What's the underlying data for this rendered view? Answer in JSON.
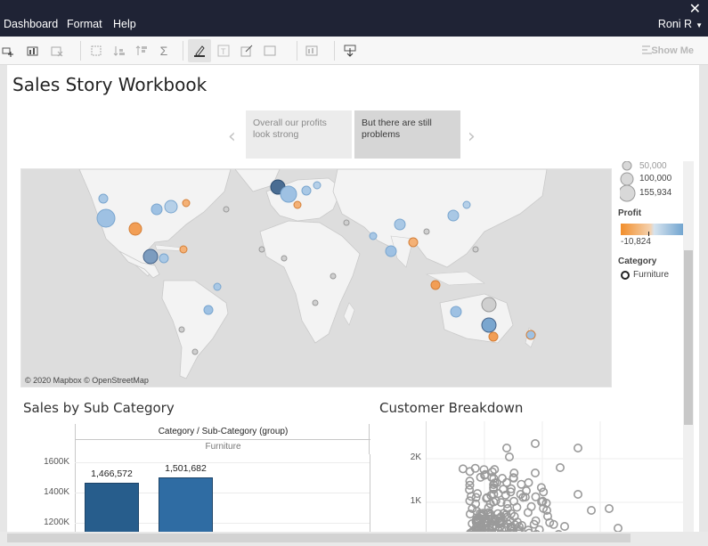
{
  "menu": {
    "items": [
      "Dashboard",
      "Format",
      "Help"
    ],
    "user": "Roni R",
    "close_symbol": "✕"
  },
  "toolbar": {
    "show_me_label": "Show Me",
    "icons": [
      "data-source-icon",
      "new-worksheet-icon",
      "clear-sheet-icon",
      "swap-icon",
      "sort-ascending-icon",
      "sort-descending-icon",
      "totals-icon",
      "highlight-icon",
      "labels-icon",
      "annotate-icon",
      "fit-icon",
      "presentation-icon",
      "download-icon"
    ]
  },
  "story": {
    "title": "Sales Story Workbook",
    "points": [
      "Overall our profits look strong",
      "But there are still problems"
    ],
    "prev_arrow": "‹",
    "next_arrow": "›"
  },
  "map": {
    "attribution": "© 2020 Mapbox  © OpenStreetMap"
  },
  "legend": {
    "size_values": [
      "50,000",
      "100,000",
      "155,934"
    ],
    "profit_title": "Profit",
    "profit_min": "-10,824",
    "category_title": "Category",
    "category_item": "Furniture",
    "colors": {
      "negative": "#f28e2b",
      "positive": "#4e79a7"
    }
  },
  "bar_chart": {
    "title": "Sales by Sub Category",
    "header": "Category / Sub-Category (group)",
    "subheader": "Furniture",
    "chart_data": {
      "type": "bar",
      "categories": [
        "",
        ""
      ],
      "values": [
        1466572,
        1501682
      ],
      "value_labels": [
        "1,466,572",
        "1,501,682"
      ],
      "yticks": [
        "1600K",
        "1400K",
        "1200K"
      ],
      "colors": [
        "#275d8c",
        "#2f6ca3"
      ]
    }
  },
  "scatter": {
    "title": "Customer Breakdown",
    "yticks": [
      "2K",
      "1K"
    ]
  }
}
